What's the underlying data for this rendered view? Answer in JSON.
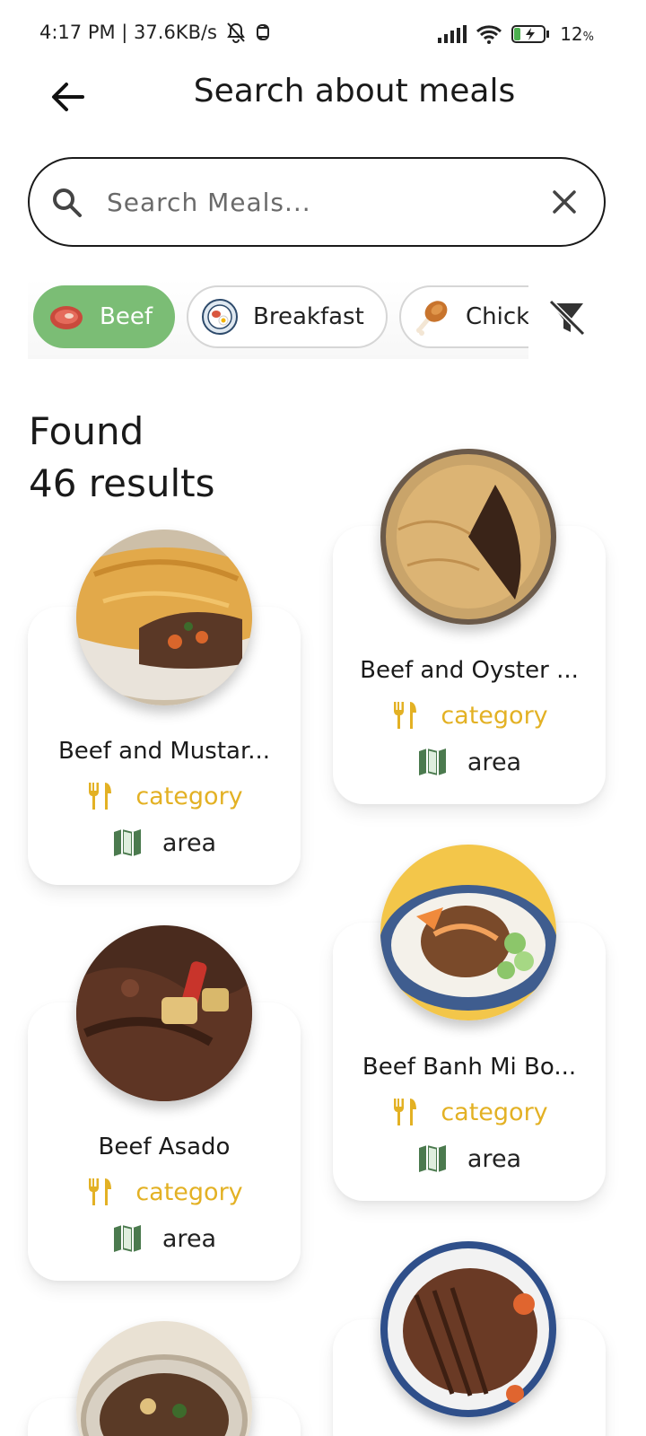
{
  "status_bar": {
    "time_speed": "4:17 PM | 37.6KB/s",
    "battery": "12"
  },
  "header": {
    "title": "Search about meals",
    "back_icon": "arrow-left-icon"
  },
  "search": {
    "placeholder": "Search Meals...",
    "value": "",
    "icon": "search-icon",
    "clear_icon": "close-icon"
  },
  "filters": {
    "chips": [
      {
        "label": "Beef",
        "selected": true
      },
      {
        "label": "Breakfast",
        "selected": false
      },
      {
        "label": "Chick",
        "selected": false
      }
    ],
    "clear_filter_icon": "filter-off-icon",
    "accent_color": "#7bbd75"
  },
  "results": {
    "found_label": "Found",
    "count_label": "46 results"
  },
  "meals": [
    {
      "title": "Beef and Mustar...",
      "category": "category",
      "area": "area"
    },
    {
      "title": "Beef and Oyster ...",
      "category": "category",
      "area": "area"
    },
    {
      "title": "Beef Asado",
      "category": "category",
      "area": "area"
    },
    {
      "title": "Beef Banh Mi Bo...",
      "category": "category",
      "area": "area"
    }
  ],
  "colors": {
    "category": "#e3b124",
    "area_icon": "#4b7a4e"
  }
}
